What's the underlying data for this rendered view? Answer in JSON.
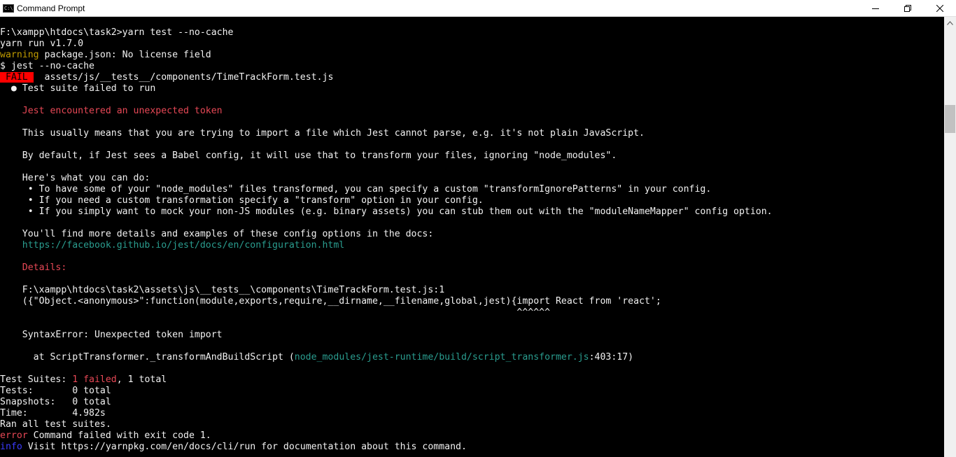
{
  "window": {
    "title": "Command Prompt",
    "app_icon_glyph": "C:\\",
    "controls": [
      "minimize-icon",
      "maximize-icon",
      "close-icon"
    ]
  },
  "console": {
    "lines": [
      {
        "segments": [
          {
            "text": "F:\\xampp\\htdocs\\task2>yarn test --no-cache",
            "style": "b"
          }
        ]
      },
      {
        "segments": [
          {
            "text": "yarn run v1.7.0",
            "style": "b"
          }
        ]
      },
      {
        "segments": [
          {
            "text": "warning",
            "style": "yellow"
          },
          {
            "text": " package.json: No license field",
            "style": "b"
          }
        ]
      },
      {
        "segments": [
          {
            "text": "$ jest --no-cache",
            "style": "b"
          }
        ]
      },
      {
        "segments": [
          {
            "text": " FAIL ",
            "style": "fail-badge"
          },
          {
            "text": "  assets/js/__tests__/components/",
            "style": "b"
          },
          {
            "text": "TimeTrackForm.test.js",
            "style": "b"
          }
        ]
      },
      {
        "segments": [
          {
            "text": "  ● Test suite failed to run",
            "style": "b"
          }
        ]
      },
      {
        "segments": [
          {
            "text": "",
            "style": "b"
          }
        ]
      },
      {
        "segments": [
          {
            "text": "    Jest encountered an unexpected token",
            "style": "red"
          }
        ]
      },
      {
        "segments": [
          {
            "text": "",
            "style": "b"
          }
        ]
      },
      {
        "segments": [
          {
            "text": "    This usually means that you are trying to import a file which Jest cannot parse, e.g. it's not plain JavaScript.",
            "style": "b"
          }
        ]
      },
      {
        "segments": [
          {
            "text": "",
            "style": "b"
          }
        ]
      },
      {
        "segments": [
          {
            "text": "    By default, if Jest sees a Babel config, it will use that to transform your files, ignoring \"node_modules\".",
            "style": "b"
          }
        ]
      },
      {
        "segments": [
          {
            "text": "",
            "style": "b"
          }
        ]
      },
      {
        "segments": [
          {
            "text": "    Here's what you can do:",
            "style": "b"
          }
        ]
      },
      {
        "segments": [
          {
            "text": "     • To have some of your \"node_modules\" files transformed, you can specify a custom ",
            "style": "b"
          },
          {
            "text": "\"transformIgnorePatterns\"",
            "style": "b"
          },
          {
            "text": " in your config.",
            "style": "b"
          }
        ]
      },
      {
        "segments": [
          {
            "text": "     • If you need a custom transformation specify a ",
            "style": "b"
          },
          {
            "text": "\"transform\"",
            "style": "b"
          },
          {
            "text": " option in your config.",
            "style": "b"
          }
        ]
      },
      {
        "segments": [
          {
            "text": "     • If you simply want to mock your non-JS modules (e.g. binary assets) you can stub them out with the ",
            "style": "b"
          },
          {
            "text": "\"moduleNameMapper\"",
            "style": "b"
          },
          {
            "text": " config option.",
            "style": "b"
          }
        ]
      },
      {
        "segments": [
          {
            "text": "",
            "style": "b"
          }
        ]
      },
      {
        "segments": [
          {
            "text": "    You'll find more details and examples of these config options in the docs:",
            "style": "b"
          }
        ]
      },
      {
        "segments": [
          {
            "text": "    https://facebook.github.io/jest/docs/en/configuration.html",
            "style": "cyan-link"
          }
        ]
      },
      {
        "segments": [
          {
            "text": "",
            "style": "b"
          }
        ]
      },
      {
        "segments": [
          {
            "text": "    Details:",
            "style": "red"
          }
        ]
      },
      {
        "segments": [
          {
            "text": "",
            "style": "b"
          }
        ]
      },
      {
        "segments": [
          {
            "text": "    F:\\xampp\\htdocs\\task2\\assets\\js\\__tests__\\components\\TimeTrackForm.test.js:1",
            "style": "b"
          }
        ]
      },
      {
        "segments": [
          {
            "text": "    ({\"Object.<anonymous>\":function(module,exports,require,__dirname,__filename,global,jest){import React from 'react';",
            "style": "b"
          }
        ]
      },
      {
        "segments": [
          {
            "text": "                                                                                             ^^^^^^",
            "style": "b"
          }
        ]
      },
      {
        "segments": [
          {
            "text": "",
            "style": "b"
          }
        ]
      },
      {
        "segments": [
          {
            "text": "    SyntaxError: Unexpected token import",
            "style": "b"
          }
        ]
      },
      {
        "segments": [
          {
            "text": "",
            "style": "b"
          }
        ]
      },
      {
        "segments": [
          {
            "text": "      at ScriptTransformer._transformAndBuildScript (",
            "style": "b"
          },
          {
            "text": "node_modules/jest-runtime/build/script_transformer.js",
            "style": "cyan-link"
          },
          {
            "text": ":403:17)",
            "style": "b"
          }
        ]
      },
      {
        "segments": [
          {
            "text": "",
            "style": "b"
          }
        ]
      },
      {
        "segments": [
          {
            "text": "Test Suites: ",
            "style": "b"
          },
          {
            "text": "1 failed",
            "style": "red"
          },
          {
            "text": ", 1 total",
            "style": "b"
          }
        ]
      },
      {
        "segments": [
          {
            "text": "Tests:       0 total",
            "style": "b"
          }
        ]
      },
      {
        "segments": [
          {
            "text": "Snapshots:   0 total",
            "style": "b"
          }
        ]
      },
      {
        "segments": [
          {
            "text": "Time:        4.982s",
            "style": "b"
          }
        ]
      },
      {
        "segments": [
          {
            "text": "Ran all test suites.",
            "style": "b"
          }
        ]
      },
      {
        "segments": [
          {
            "text": "error",
            "style": "red"
          },
          {
            "text": " Command failed with exit code 1.",
            "style": "b"
          }
        ]
      },
      {
        "segments": [
          {
            "text": "info",
            "style": "blue"
          },
          {
            "text": " Visit ",
            "style": "b"
          },
          {
            "text": "https://yarnpkg.com/en/docs/cli/run",
            "style": "b"
          },
          {
            "text": " for documentation about this command.",
            "style": "b"
          }
        ]
      }
    ]
  }
}
